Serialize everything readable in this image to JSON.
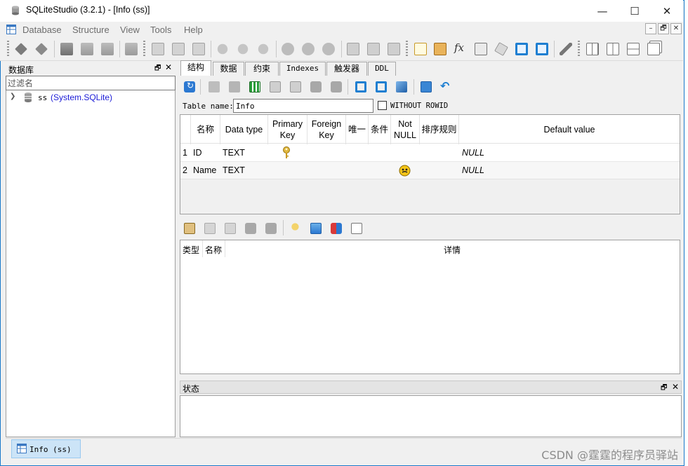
{
  "window": {
    "title": "SQLiteStudio (3.2.1) - [Info (ss)]",
    "controls": {
      "minimize": "—",
      "maximize": "☐",
      "close": "✕"
    }
  },
  "menu": {
    "items": [
      "Database",
      "Structure",
      "View",
      "Tools",
      "Help"
    ],
    "mdi_controls": [
      "–",
      "🗗",
      "✕"
    ]
  },
  "database_panel": {
    "title": "数据库",
    "filter_placeholder": "过滤名",
    "tree": [
      {
        "name": "ss",
        "driver": "(System.SQLite)"
      }
    ]
  },
  "tabs": [
    "结构",
    "数据",
    "约束",
    "Indexes",
    "触发器",
    "DDL"
  ],
  "active_tab": "结构",
  "table_editor": {
    "table_name_label": "Table name:",
    "table_name_value": "Info",
    "without_rowid_label": "WITHOUT ROWID",
    "without_rowid_checked": false,
    "columns_header": [
      "名称",
      "Data type",
      "Primary Key",
      "Foreign Key",
      "唯一",
      "条件",
      "Not NULL",
      "排序规则",
      "Default value"
    ],
    "rows": [
      {
        "num": "1",
        "name": "ID",
        "type": "TEXT",
        "primary_key": true,
        "not_null": false,
        "default": "NULL"
      },
      {
        "num": "2",
        "name": "Name",
        "type": "TEXT",
        "primary_key": false,
        "not_null": true,
        "default": "NULL"
      }
    ]
  },
  "constraints_panel": {
    "header": [
      "类型",
      "名称",
      "详情"
    ]
  },
  "status_panel": {
    "title": "状态"
  },
  "taskbar": {
    "items": [
      {
        "label": "Info (ss)"
      }
    ]
  },
  "watermark": "CSDN @霆霆的程序员驿站",
  "colors": {
    "accent": "#1979ca",
    "tree_driver": "#1a1ad6",
    "task_active": "#cce4f7"
  }
}
